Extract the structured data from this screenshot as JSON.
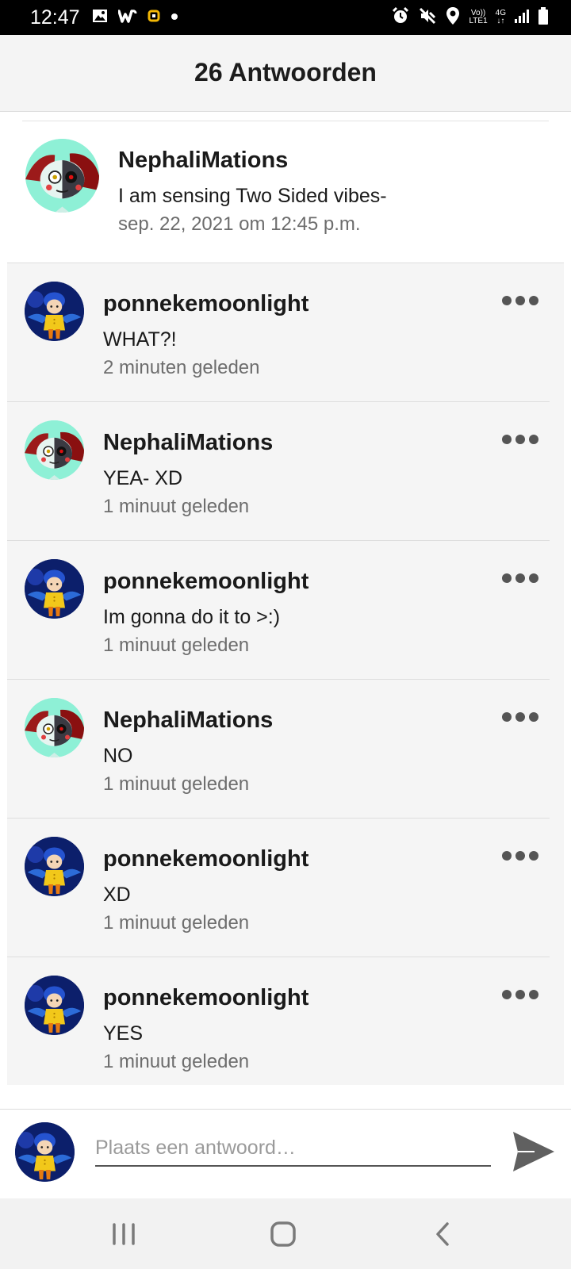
{
  "status_bar": {
    "time": "12:47",
    "left_icons": [
      "image-icon",
      "wattpad-icon",
      "notification-icon",
      "dot-icon"
    ],
    "right_icons": [
      "alarm-icon",
      "mute-icon",
      "location-icon",
      "volte-icon",
      "4g-icon",
      "signal-icon",
      "battery-icon"
    ],
    "net_top": "Vo))",
    "net_bottom": "LTE1",
    "net_4g": "4G"
  },
  "header": {
    "title": "26 Antwoorden"
  },
  "original_comment": {
    "username": "NephaliMations",
    "text": "I am sensing Two Sided vibes-",
    "timestamp": "sep. 22, 2021 om 12:45 p.m.",
    "avatar": "nephali-avatar"
  },
  "replies": [
    {
      "username": "ponnekemoonlight",
      "text": "WHAT?!",
      "timestamp": "2 minuten geleden",
      "avatar": "ponneke-avatar"
    },
    {
      "username": "NephaliMations",
      "text": "YEA- XD",
      "timestamp": "1 minuut geleden",
      "avatar": "nephali-avatar"
    },
    {
      "username": "ponnekemoonlight",
      "text": "Im gonna do it to >:)",
      "timestamp": "1 minuut geleden",
      "avatar": "ponneke-avatar"
    },
    {
      "username": "NephaliMations",
      "text": "NO",
      "timestamp": "1 minuut geleden",
      "avatar": "nephali-avatar"
    },
    {
      "username": "ponnekemoonlight",
      "text": "XD",
      "timestamp": "1 minuut geleden",
      "avatar": "ponneke-avatar"
    },
    {
      "username": "ponnekemoonlight",
      "text": "YES",
      "timestamp": "1 minuut geleden",
      "avatar": "ponneke-avatar"
    }
  ],
  "composer": {
    "placeholder": "Plaats een antwoord…",
    "value": "",
    "send_icon": "send-icon"
  },
  "navbar": {
    "icons": [
      "recent-apps-icon",
      "home-icon",
      "back-icon"
    ]
  },
  "colors": {
    "status_bar": "#000000",
    "header_bg": "#f4f4f4",
    "reply_bg": "#f5f5f5",
    "text": "#1a1a1a",
    "muted": "#6d6d6d",
    "avatar_dark": "#0c1f6b",
    "avatar_mint": "#8ef0d6"
  }
}
